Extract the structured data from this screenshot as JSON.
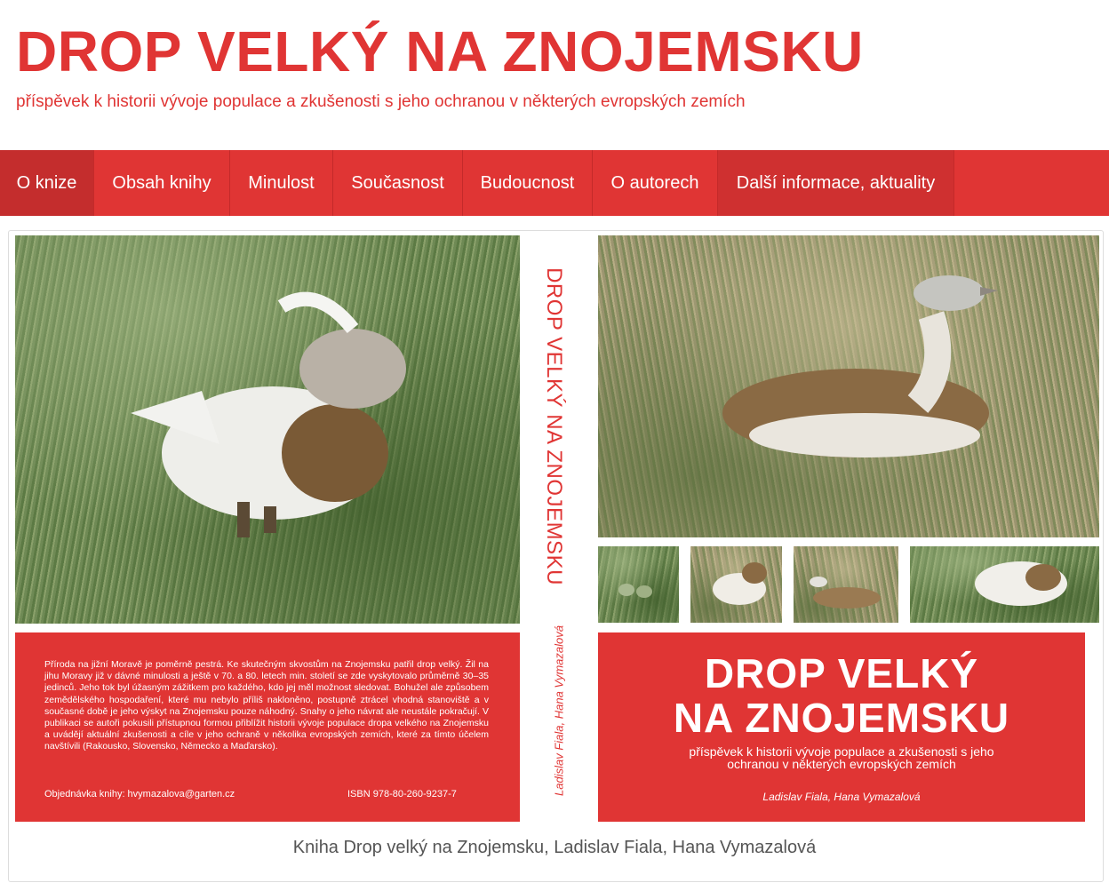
{
  "header": {
    "title": "DROP VELKÝ NA ZNOJEMSKU",
    "description": "příspěvek k historii vývoje populace a zkušenosti s jeho ochranou v některých evropských zemích"
  },
  "nav": {
    "items": [
      {
        "label": "O knize"
      },
      {
        "label": "Obsah knihy"
      },
      {
        "label": "Minulost"
      },
      {
        "label": "Současnost"
      },
      {
        "label": "Budoucnost"
      },
      {
        "label": "O autorech"
      },
      {
        "label": "Další informace, aktuality"
      }
    ]
  },
  "cover": {
    "back_blurb": "Příroda na jižní Moravě je poměrně pestrá. Ke skutečným skvostům na Znojemsku patřil drop velký. Žil na jihu Moravy již v dávné minulosti a ještě v 70. a 80. letech min. století se zde vyskytovalo průměrně 30–35 jedinců. Jeho tok byl úžasným zážitkem pro každého, kdo jej měl možnost sledovat. Bohužel ale způsobem zemědělského hospodaření, které mu nebylo příliš nakloněno, postupně ztrácel vhodná stanoviště a v současné době je jeho výskyt na Znojemsku pouze náhodný. Snahy o jeho návrat ale neustále pokračují. V publikaci se autoři pokusili přístupnou formou přiblížit historii vývoje populace dropa velkého na Znojemsku a uvádějí aktuální zkušenosti a cíle v jeho ochraně v několika evropských zemích, které za tímto účelem navštívili (Rakousko, Slovensko, Německo a Maďarsko).",
    "order": "Objednávka knihy: hvymazalova@garten.cz",
    "isbn": "ISBN 978-80-260-9237-7",
    "spine_title": "DROP VELKÝ NA ZNOJEMSKU",
    "spine_authors": "Ladislav Fiala, Hana Vymazalová",
    "front_title_line1": "DROP VELKÝ",
    "front_title_line2": "NA ZNOJEMSKU",
    "front_subtitle_line1": "příspěvek k historii vývoje populace a zkušenosti s jeho",
    "front_subtitle_line2": "ochranou v některých evropských zemích",
    "front_authors": "Ladislav Fiala, Hana Vymazalová"
  },
  "caption": "Kniha Drop velký na Znojemsku, Ladislav Fiala, Hana Vymazalová",
  "colors": {
    "accent": "#e03534",
    "accent_dark": "#c42d2d",
    "caption_text": "#555555"
  }
}
